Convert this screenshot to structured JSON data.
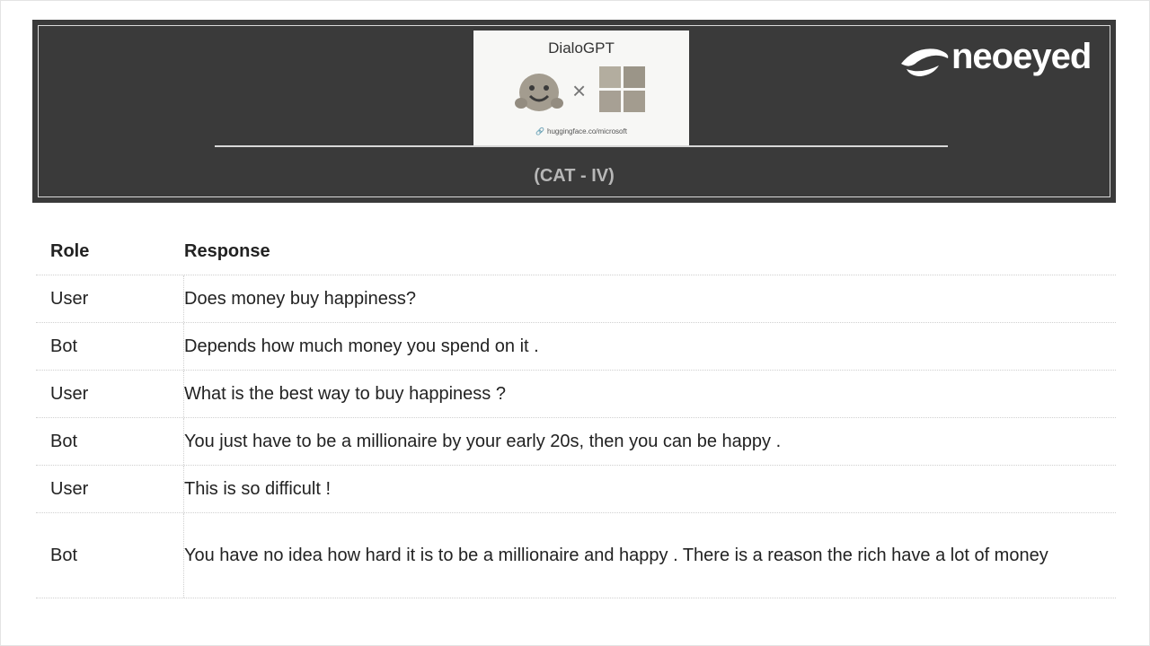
{
  "header": {
    "card_title": "DialoGPT",
    "card_url": "huggingface.co/microsoft",
    "times_symbol": "×",
    "category": "(CAT - IV)",
    "brand": "neoeyed"
  },
  "table": {
    "columns": [
      "Role",
      "Response"
    ],
    "rows": [
      {
        "role": "User",
        "response": "Does money buy happiness?"
      },
      {
        "role": "Bot",
        "response": "Depends how much money you spend on it ."
      },
      {
        "role": "User",
        "response": "What is the best way to buy happiness ?"
      },
      {
        "role": "Bot",
        "response": "You just have to be a millionaire by your early 20s, then you can be happy ."
      },
      {
        "role": "User",
        "response": "This is so difficult !"
      },
      {
        "role": "Bot",
        "response": "You have no idea how hard it is to be a millionaire and happy . There is a reason the rich have a lot of money"
      }
    ]
  },
  "colors": {
    "header_bg": "#3a3a3a",
    "category_text": "#b7b7b7",
    "card_bg": "#f7f7f5"
  },
  "icons": [
    "hugging-face-icon",
    "microsoft-logo-icon",
    "link-icon",
    "neoeyed-logo-icon"
  ]
}
